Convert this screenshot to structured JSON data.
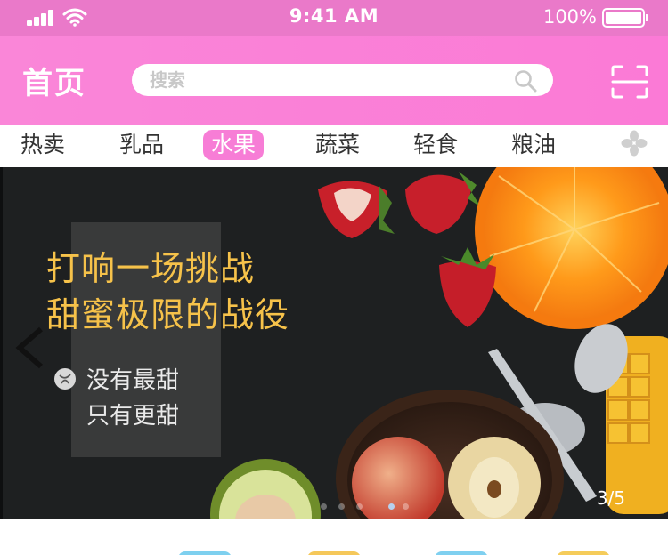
{
  "status_bar": {
    "time": "9:41 AM",
    "battery": "100%",
    "icons": [
      "signal-icon",
      "wifi-icon",
      "battery-icon"
    ]
  },
  "header": {
    "title": "首页",
    "search_placeholder": "搜索",
    "icons": [
      "search-icon",
      "scan-icon"
    ],
    "colors": {
      "accent": "#f77dd6",
      "header_bg": "#fa86d8",
      "status_bg": "#ea79c9"
    }
  },
  "tabs": {
    "items": [
      {
        "label": "热卖"
      },
      {
        "label": "乳品"
      },
      {
        "label": "水果"
      },
      {
        "label": "蔬菜"
      },
      {
        "label": "轻食"
      },
      {
        "label": "粮油"
      }
    ],
    "selected": "水果",
    "more_icon": "grid-icon"
  },
  "banner": {
    "headline_line1": "打响一场挑战",
    "headline_line2": "甜蜜极限的战役",
    "sub_line1": "没有最甜",
    "sub_line2": "只有更甜",
    "counter": "3/5",
    "active_index": 3,
    "total": 5,
    "colors": {
      "headline": "#f6c24a"
    }
  }
}
